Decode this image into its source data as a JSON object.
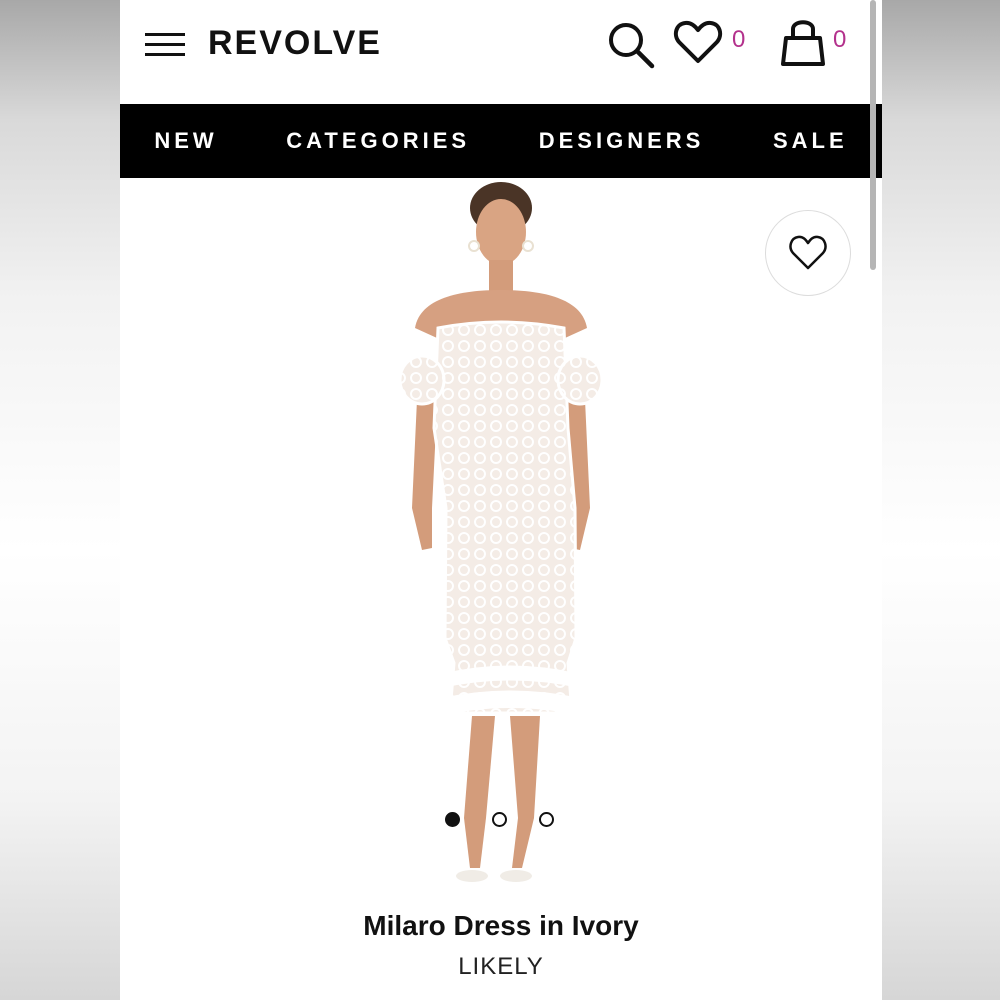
{
  "header": {
    "logo": "REVOLVE",
    "menu_icon": "hamburger-menu-icon",
    "search_icon": "search-icon",
    "wishlist_icon": "heart-icon",
    "wishlist_count": "0",
    "bag_icon": "shopping-bag-icon",
    "bag_count": "0",
    "count_color": "#b3318c"
  },
  "nav": {
    "items": [
      {
        "label": "NEW"
      },
      {
        "label": "CATEGORIES"
      },
      {
        "label": "DESIGNERS"
      },
      {
        "label": "SALE"
      }
    ]
  },
  "product": {
    "favorite_icon": "heart-outline-icon",
    "carousel": {
      "total": 3,
      "active_index": 0
    },
    "name": "Milaro Dress in Ivory",
    "brand": "LIKELY"
  }
}
